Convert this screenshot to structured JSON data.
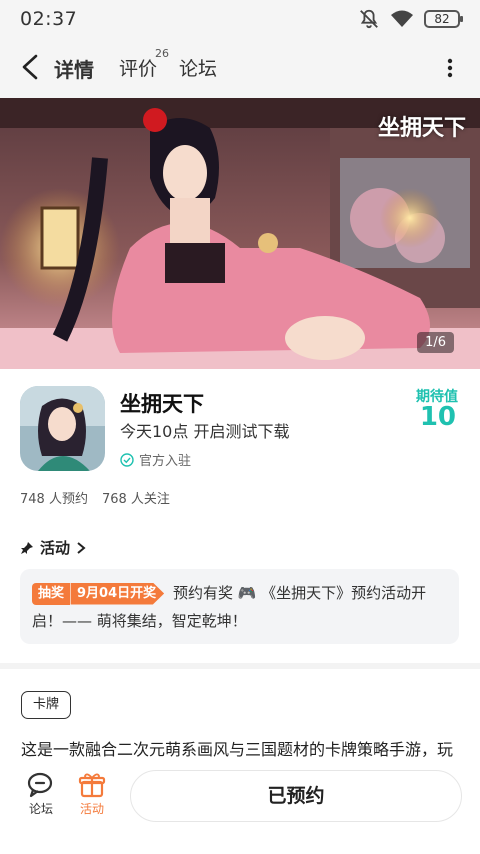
{
  "status_bar": {
    "time": "02:37",
    "battery": "82"
  },
  "header": {
    "tabs": [
      {
        "label": "详情",
        "active": true
      },
      {
        "label": "评价",
        "count": "26"
      },
      {
        "label": "论坛"
      }
    ],
    "accent_color": "#2ed6c5"
  },
  "banner": {
    "logo_text": "坐拥天下",
    "page_indicator": "1/6"
  },
  "game": {
    "title": "坐拥天下",
    "subtitle": "今天10点 开启测试下载",
    "official_label": "官方入驻",
    "expect_label": "期待值",
    "expect_value": "10",
    "reservations": "748 人预约",
    "followers": "768 人关注"
  },
  "activity": {
    "heading": "活动",
    "badge_type": "抽奖",
    "badge_date": "9月04日开奖",
    "text": "预约有奖 🎮 《坐拥天下》预约活动开启！—— 萌将集结，智定乾坤！"
  },
  "tag": "卡牌",
  "description": "这是一款融合二次元萌系画风与三国题材的卡牌策略手游，玩",
  "bottom_nav": {
    "forum_label": "论坛",
    "activity_label": "活动",
    "reserve_button": "已预约"
  },
  "colors": {
    "accent": "#1fc1b0",
    "orange": "#f47a3b"
  }
}
